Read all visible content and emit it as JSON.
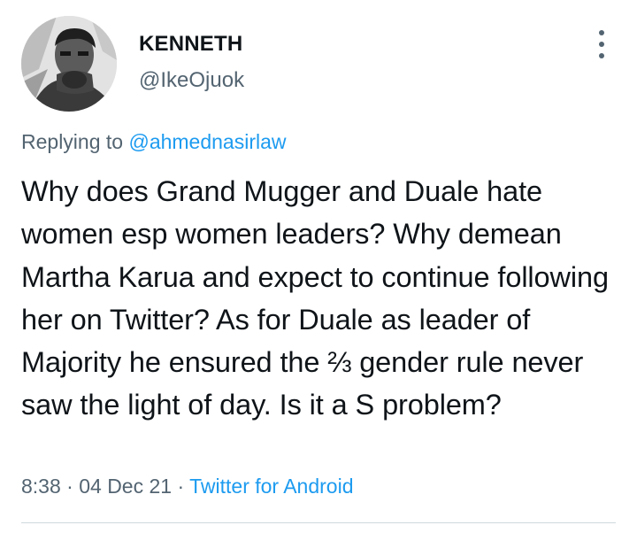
{
  "author": {
    "name": "KENNETH",
    "handle": "@IkeOjuok",
    "avatar_icon": "profile-photo"
  },
  "menu_icon": "more-vertical-icon",
  "reply": {
    "prefix": "Replying to",
    "mention": "@ahmednasirlaw"
  },
  "tweet": {
    "text": "Why does Grand Mugger and Duale hate women esp women leaders? Why demean Martha Karua and expect to continue following her on Twitter? As for Duale as leader of Majority he ensured the ⅔ gender rule never saw the light of day. Is it a S problem?"
  },
  "meta": {
    "time": "8:38",
    "separator": "·",
    "date": "04 Dec 21",
    "source": "Twitter for Android"
  },
  "colors": {
    "text": "#0f1419",
    "secondary": "#536471",
    "link": "#1d9bf0",
    "divider": "#cfd9de"
  }
}
